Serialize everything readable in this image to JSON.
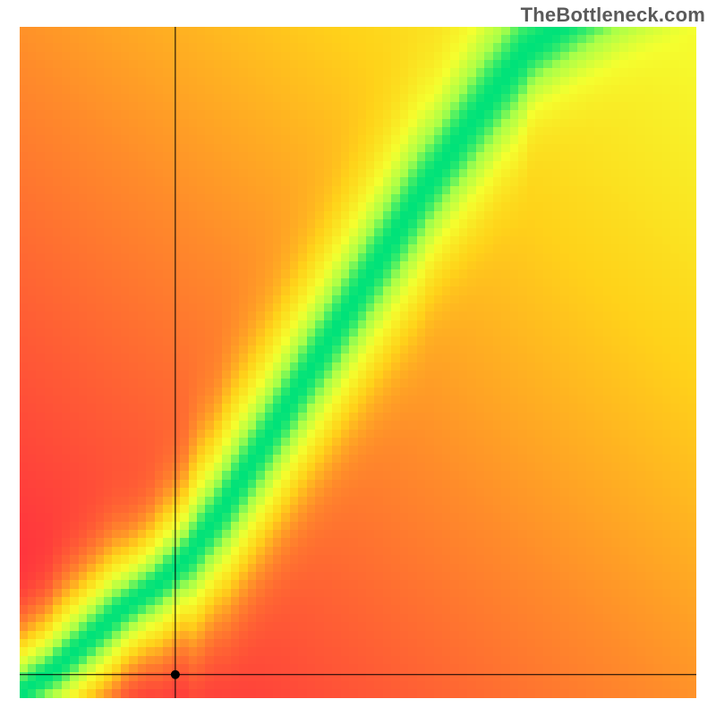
{
  "attribution": "TheBottleneck.com",
  "chart_data": {
    "type": "heatmap",
    "title": "",
    "xlabel": "",
    "ylabel": "",
    "xlim": [
      0,
      1
    ],
    "ylim": [
      0,
      1
    ],
    "grid_cells": 80,
    "colormap_stops": [
      {
        "t": 0.0,
        "color": "#ff1a44"
      },
      {
        "t": 0.35,
        "color": "#ff8a2b"
      },
      {
        "t": 0.55,
        "color": "#ffd31a"
      },
      {
        "t": 0.75,
        "color": "#f5ff2f"
      },
      {
        "t": 0.9,
        "color": "#a8ff4a"
      },
      {
        "t": 1.0,
        "color": "#00e27a"
      }
    ],
    "crosshair": {
      "x": 0.23,
      "y": 0.035,
      "dot_radius": 5
    },
    "ridge_points": [
      {
        "x": 0.0,
        "y": 0.006
      },
      {
        "x": 0.05,
        "y": 0.04
      },
      {
        "x": 0.1,
        "y": 0.085
      },
      {
        "x": 0.15,
        "y": 0.13
      },
      {
        "x": 0.2,
        "y": 0.165
      },
      {
        "x": 0.25,
        "y": 0.21
      },
      {
        "x": 0.3,
        "y": 0.28
      },
      {
        "x": 0.35,
        "y": 0.36
      },
      {
        "x": 0.4,
        "y": 0.44
      },
      {
        "x": 0.45,
        "y": 0.52
      },
      {
        "x": 0.5,
        "y": 0.6
      },
      {
        "x": 0.55,
        "y": 0.68
      },
      {
        "x": 0.6,
        "y": 0.76
      },
      {
        "x": 0.65,
        "y": 0.83
      },
      {
        "x": 0.7,
        "y": 0.9
      },
      {
        "x": 0.75,
        "y": 0.965
      },
      {
        "x": 0.8,
        "y": 1.0
      }
    ],
    "ridge_half_width": 0.055,
    "right_edge_warmth": 0.58
  }
}
